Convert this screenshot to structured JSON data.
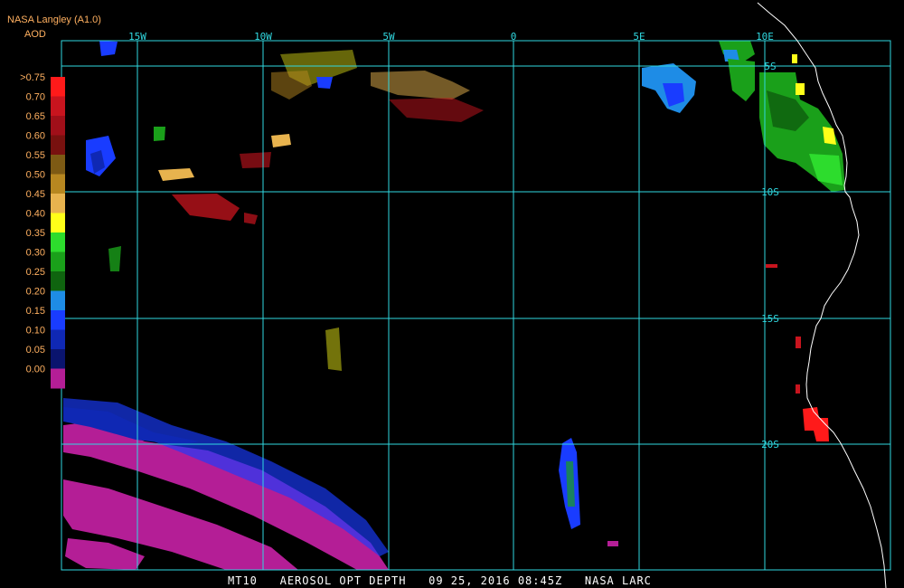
{
  "header": {
    "org_line": "NASA Langley (A1.0)",
    "product_label": "AOD"
  },
  "colors": {
    "header_text": "#ffb060",
    "grid": "#30d8e0",
    "coast": "#ffffff",
    "background": "#000000"
  },
  "legend": {
    "labels": [
      ">0.75",
      "0.70",
      "0.65",
      "0.60",
      "0.55",
      "0.50",
      "0.45",
      "0.40",
      "0.35",
      "0.30",
      "0.25",
      "0.20",
      "0.15",
      "0.10",
      "0.05",
      "0.00"
    ],
    "colors": [
      "#ff1a1a",
      "#c8141e",
      "#a00f19",
      "#78110f",
      "#7d5a14",
      "#b78720",
      "#e8b34e",
      "#ffff19",
      "#2ddc2d",
      "#1aa01a",
      "#0f640f",
      "#1e8ce6",
      "#193cff",
      "#0f28b4",
      "#0a146e",
      "#b41e96"
    ]
  },
  "map": {
    "lon_labels": [
      "15W",
      "10W",
      "5W",
      "0",
      "5E",
      "10E"
    ],
    "lat_labels": [
      "5S",
      "10S",
      "15S",
      "20S"
    ]
  },
  "footer": {
    "sat": "MT10",
    "product": "AEROSOL OPT DEPTH",
    "date": "09 25, 2016",
    "time": "08:45Z",
    "source": "NASA LARC"
  }
}
